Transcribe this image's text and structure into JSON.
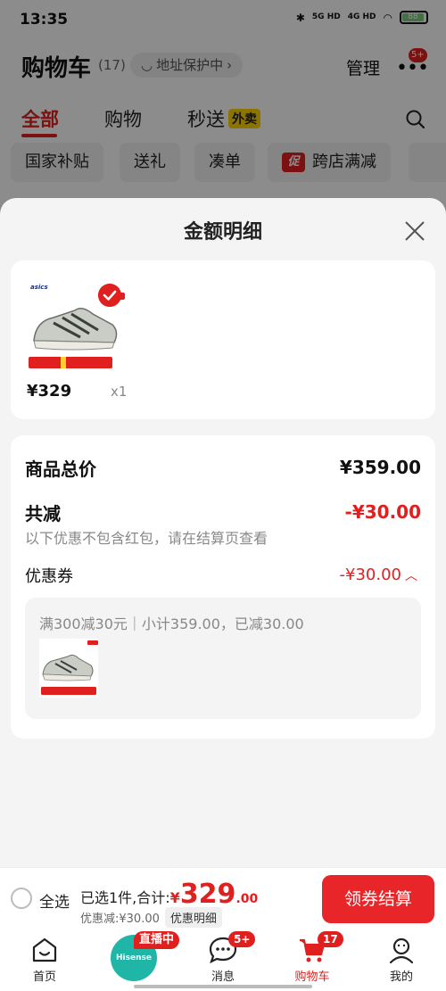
{
  "status_bar": {
    "time": "13:35",
    "network_a": "5G HD",
    "network_b": "4G HD",
    "battery": "88"
  },
  "header": {
    "title": "购物车",
    "count": "(17)",
    "address_protect": "地址保护中",
    "manage": "管理",
    "more_badge": "5+"
  },
  "tabs": [
    {
      "label": "全部",
      "active": true
    },
    {
      "label": "购物",
      "active": false
    },
    {
      "label": "秒送",
      "tag": "外卖",
      "active": false
    }
  ],
  "chips": [
    {
      "label": "国家补贴"
    },
    {
      "label": "送礼"
    },
    {
      "label": "凑单"
    },
    {
      "label": "跨店满减",
      "promo_icon": "促"
    }
  ],
  "sheet": {
    "title": "金额明细",
    "item": {
      "brand": "asics",
      "price": "¥329",
      "quantity": "x1"
    },
    "summary": {
      "total_label": "商品总价",
      "total_value": "¥359.00",
      "reduce_label": "共减",
      "reduce_value": "-¥30.00",
      "reduce_note": "以下优惠不包含红包，请在结算页查看",
      "coupon_label": "优惠券",
      "coupon_value": "-¥30.00",
      "coupon_desc": "满300减30元｜小计359.00，已减30.00"
    }
  },
  "checkout": {
    "select_all": "全选",
    "selected_text": "已选1件,合计:",
    "currency": "¥",
    "total_int": "329",
    "total_dec": ".00",
    "discount_text": "优惠减:¥30.00",
    "detail_label": "优惠明细",
    "button": "领券结算"
  },
  "tabbar": {
    "items": [
      {
        "label": "首页",
        "icon": "home-icon"
      },
      {
        "label": "",
        "icon": "live-icon",
        "badge": "直播中",
        "brand": "Hisense"
      },
      {
        "label": "消息",
        "icon": "message-icon",
        "badge": "5+"
      },
      {
        "label": "购物车",
        "icon": "cart-icon",
        "badge": "17",
        "active": true
      },
      {
        "label": "我的",
        "icon": "profile-icon"
      }
    ]
  },
  "colors": {
    "accent": "#e0201f",
    "overlay": "rgba(0,0,0,0.45)",
    "waimai_tag": "#ffd400"
  }
}
